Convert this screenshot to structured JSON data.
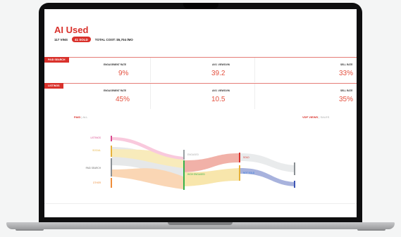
{
  "app": {
    "title": "AI Used"
  },
  "summary": {
    "vins": "117 VINS",
    "sold": "41 SOLD",
    "total_cost": "TOTAL COST: $5,704 /MO"
  },
  "sections": [
    {
      "badge": "PAID SEARCH",
      "metrics": [
        {
          "label": "ENGAGEMENT RATE",
          "value": "9%"
        },
        {
          "label": "AVG. VIEWS/VIN",
          "value": "39.2"
        },
        {
          "label": "SELL RATE",
          "value": "33%"
        }
      ]
    },
    {
      "badge": "LISTINGS",
      "metrics": [
        {
          "label": "ENGAGEMENT RATE",
          "value": "45%"
        },
        {
          "label": "AVG. VIEWS/VIN",
          "value": "10.5"
        },
        {
          "label": "SELL RATE",
          "value": "35%"
        }
      ]
    }
  ],
  "filters": {
    "left": [
      "PAID",
      "ALL"
    ],
    "right": [
      "VDP VIEWS",
      "SALES"
    ]
  },
  "sankey": {
    "sources": [
      "LISTINGS",
      "SOCIAL",
      "PAID SEARCH",
      "OTHER"
    ],
    "middle": [
      "ENGAGED",
      "HIGH ENGAGED"
    ],
    "outcomes": [
      "SOLD",
      "NOT SOLD"
    ]
  },
  "colors": {
    "brand": "#d9312b",
    "value": "#e4513f"
  }
}
